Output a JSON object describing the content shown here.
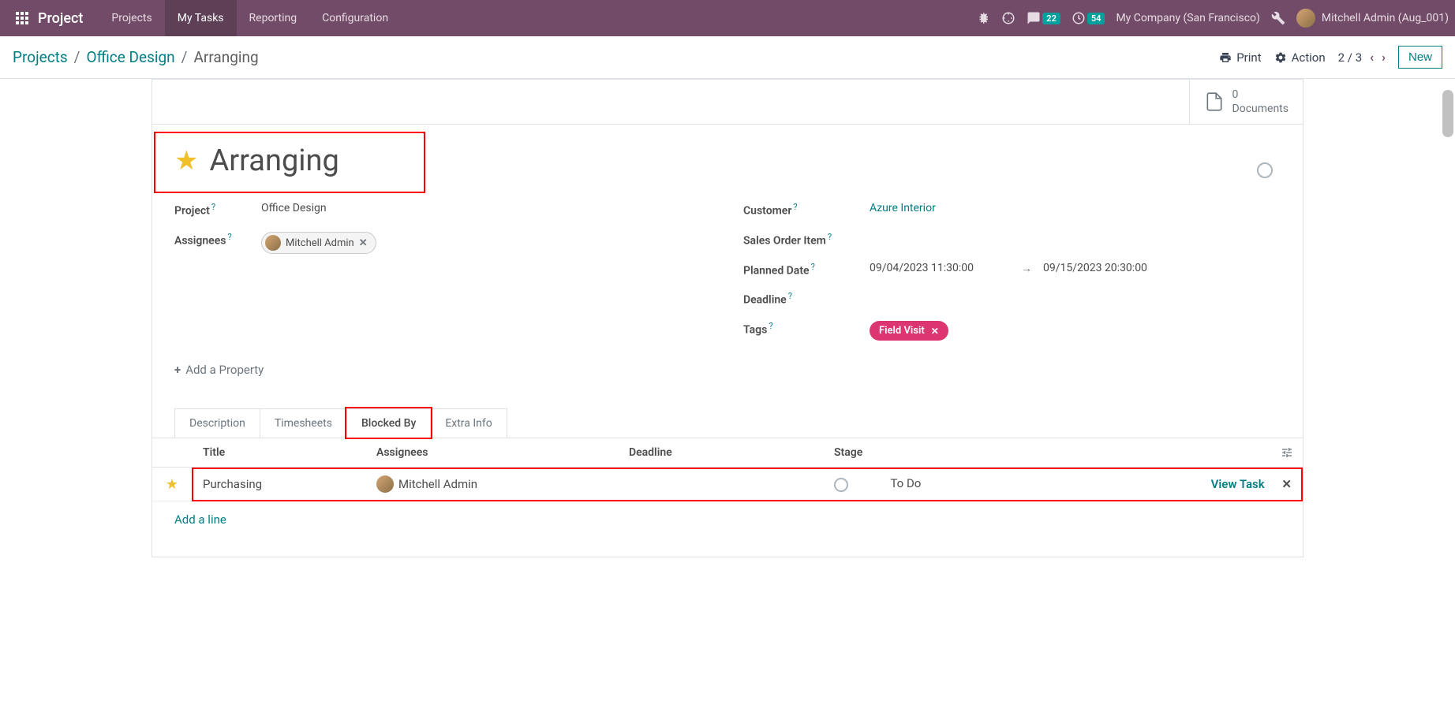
{
  "navbar": {
    "brand": "Project",
    "menu": [
      "Projects",
      "My Tasks",
      "Reporting",
      "Configuration"
    ],
    "active_index": 1,
    "messages_badge": "22",
    "activities_badge": "54",
    "company": "My Company (San Francisco)",
    "user": "Mitchell Admin (Aug_001)"
  },
  "breadcrumb": {
    "items": [
      "Projects",
      "Office Design",
      "Arranging"
    ]
  },
  "control": {
    "print": "Print",
    "action": "Action",
    "pager": "2 / 3",
    "new_btn": "New"
  },
  "stat": {
    "count": "0",
    "label": "Documents"
  },
  "task": {
    "title": "Arranging",
    "fields_left": {
      "project": {
        "label": "Project",
        "value": "Office Design"
      },
      "assignees": {
        "label": "Assignees",
        "chip": "Mitchell Admin"
      }
    },
    "fields_right": {
      "customer": {
        "label": "Customer",
        "value": "Azure Interior"
      },
      "sales_order": {
        "label": "Sales Order Item"
      },
      "planned": {
        "label": "Planned Date",
        "start": "09/04/2023 11:30:00",
        "end": "09/15/2023 20:30:00"
      },
      "deadline": {
        "label": "Deadline"
      },
      "tags": {
        "label": "Tags",
        "pill": "Field Visit"
      }
    },
    "add_property": "Add a Property"
  },
  "tabs": [
    "Description",
    "Timesheets",
    "Blocked By",
    "Extra Info"
  ],
  "tabs_active": 2,
  "table": {
    "headers": {
      "title": "Title",
      "assignees": "Assignees",
      "deadline": "Deadline",
      "stage": "Stage"
    },
    "row": {
      "title": "Purchasing",
      "assignee": "Mitchell Admin",
      "deadline": "",
      "stage": "To Do",
      "view": "View Task"
    },
    "add_line": "Add a line"
  }
}
